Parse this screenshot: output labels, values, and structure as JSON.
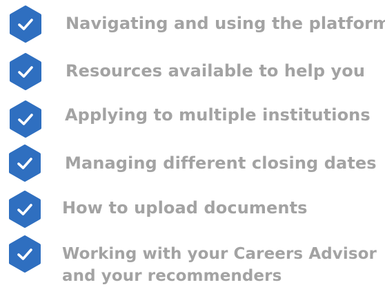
{
  "colors": {
    "badge_blue": "#2f6fc0",
    "badge_dark": "#2459a0",
    "check": "#ffffff",
    "text": "#a3a3a3"
  },
  "checklist": {
    "items": [
      {
        "icon": "check-badge-icon",
        "label": "Navigating and using the platform"
      },
      {
        "icon": "check-badge-icon",
        "label": "Resources available to help you"
      },
      {
        "icon": "check-badge-icon",
        "label": "Applying to multiple institutions"
      },
      {
        "icon": "check-badge-icon",
        "label": "Managing different closing dates"
      },
      {
        "icon": "check-badge-icon",
        "label": "How to upload documents"
      },
      {
        "icon": "check-badge-icon",
        "label": "Working with your Careers Advisor",
        "label_line2": "and your recommenders"
      }
    ]
  }
}
